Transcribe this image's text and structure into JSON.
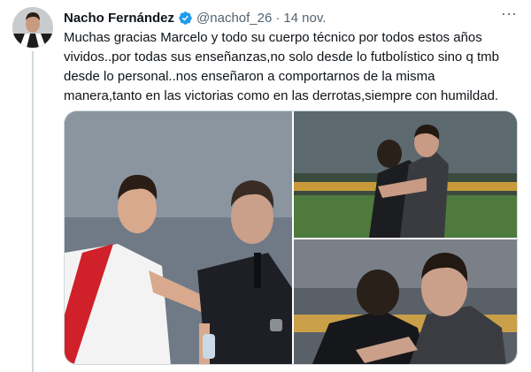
{
  "tweet": {
    "author_name": "Nacho Fernández",
    "handle": "@nachof_26",
    "separator": "·",
    "time": "14 nov.",
    "more_label": "···",
    "text": "Muchas gracias Marcelo y todo su cuerpo técnico por todos estos años\nvividos..por todas sus enseñanzas,no solo desde lo futbolístico sino q tmb\ndesde lo personal..nos enseñaron a comportarnos de la misma\nmanera,tanto en las victorias como en las derrotas,siempre con humildad."
  },
  "icons": {
    "verified": "verified-badge-icon",
    "more": "more-options-icon"
  },
  "colors": {
    "verified": "#1d9bf0",
    "text": "#0f1419",
    "secondary": "#536471",
    "border": "#cfd9de"
  }
}
